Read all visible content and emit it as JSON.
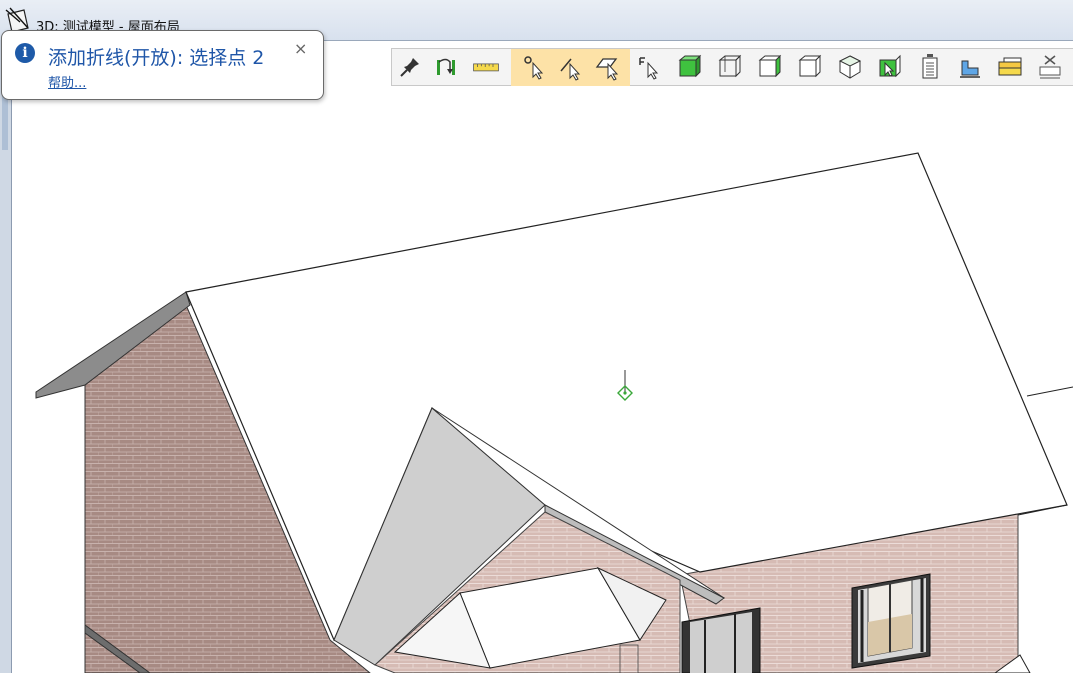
{
  "window": {
    "title": "3D: 测试模型 - 屋面布局"
  },
  "tooltip": {
    "message": "添加折线(开放): 选择点 2",
    "help_link": "帮助...",
    "close_glyph": "×",
    "info_glyph": "i"
  },
  "toolbar": {
    "items": [
      {
        "icon": "pin-icon"
      },
      {
        "icon": "connect-icon"
      },
      {
        "icon": "ruler-icon"
      },
      {
        "icon": "pick-point-icon"
      },
      {
        "icon": "pick-edge-icon"
      },
      {
        "icon": "pick-face-icon"
      },
      {
        "icon": "pick-corner-icon"
      },
      {
        "icon": "green-box-icon"
      },
      {
        "icon": "wire-box-icon"
      },
      {
        "icon": "box-side-icon"
      },
      {
        "icon": "box-front-icon"
      },
      {
        "icon": "box-iso-icon"
      },
      {
        "icon": "box-select-icon"
      },
      {
        "icon": "document-icon"
      },
      {
        "icon": "layers-icon"
      },
      {
        "icon": "stack-icon"
      },
      {
        "icon": "printer-x-icon"
      }
    ],
    "highlight_color": "#fde2a7"
  },
  "colors": {
    "brick": "#a78a83",
    "roof": "#ffffff",
    "roof_gray": "#8c8c8c",
    "accent": "#1f56a8"
  }
}
